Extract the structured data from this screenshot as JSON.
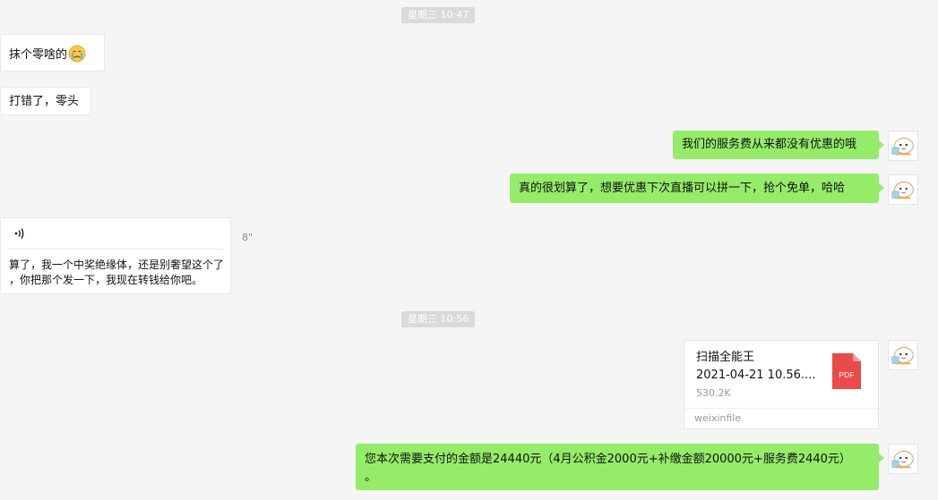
{
  "timestamps": [
    "星期三 10:47",
    "星期三 10:56"
  ],
  "messages": {
    "m1": "抹个零啥的",
    "m2": "打错了，零头",
    "m3": "我们的服务费从来都没有优惠的哦",
    "m4": "真的很划算了，想要优惠下次直播可以拼一下，抢个免单，哈哈",
    "voice": {
      "icon": "voice-wave-icon",
      "duration": "8\"",
      "transcript_line1": "算了，我一个中奖绝缘体，还是别奢望这个了",
      "transcript_line2": "，你把那个发一下，我现在转钱给你吧。"
    },
    "file": {
      "name_line1": "扫描全能王",
      "name_line2": "2021-04-21 10.56....",
      "size": "530.2K",
      "source": "weixinfile",
      "icon": "pdf-file-icon",
      "icon_label": "PDF"
    },
    "m5_line1": "您本次需要支付的金额是24440元（4月公积金2000元+补缴金额20000元+服务费2440元）",
    "m5_line2": "。"
  },
  "colors": {
    "outgoing_bubble": "#95ec69",
    "incoming_bubble": "#ffffff",
    "background": "#f5f5f5",
    "pdf_red": "#e94b4b"
  }
}
